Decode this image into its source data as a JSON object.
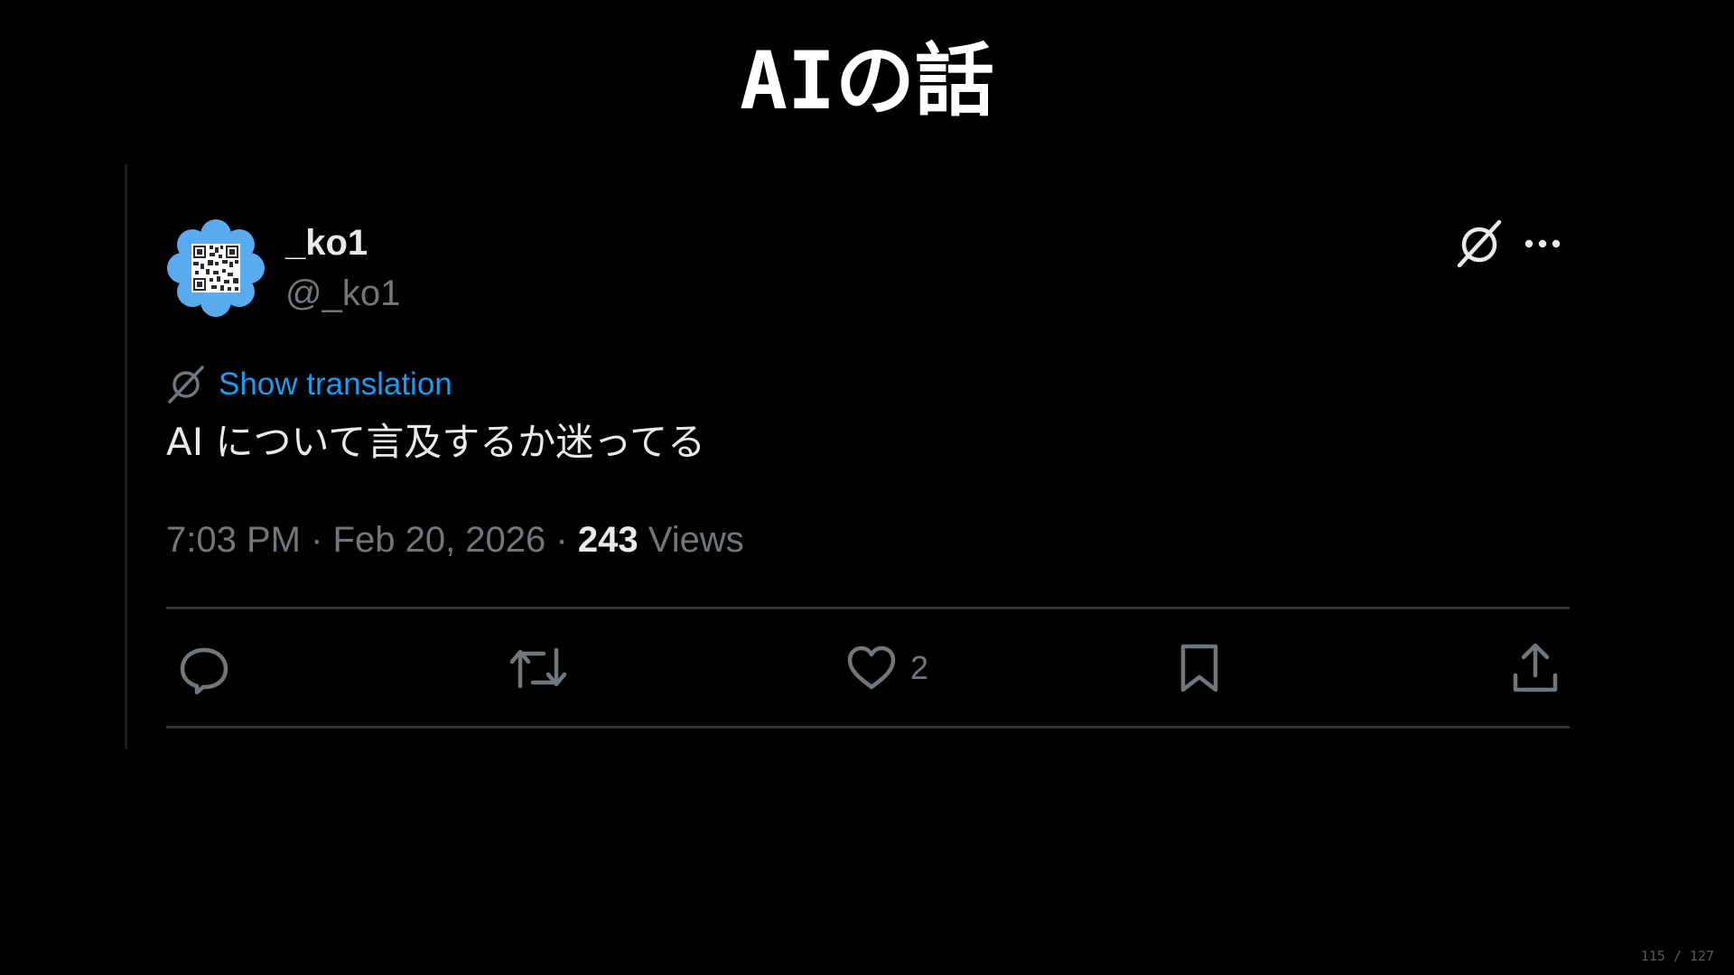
{
  "slide": {
    "title": "AIの話",
    "page_counter": "115 / 127"
  },
  "tweet": {
    "display_name": "_ko1",
    "handle": "@_ko1",
    "translate_label": "Show translation",
    "text": "AI について言及するか迷ってる",
    "time": "7:03 PM",
    "separator": "·",
    "date": "Feb 20, 2026",
    "views_count": "243",
    "views_label": "Views",
    "like_count": "2"
  },
  "icons": {
    "avatar": "qr-code-flower-avatar",
    "grok": "grok-icon",
    "more": "more-horizontal-icon",
    "translate": "translate-icon",
    "reply": "reply-icon",
    "repost": "repost-icon",
    "like": "heart-icon",
    "bookmark": "bookmark-icon",
    "share": "share-icon"
  },
  "colors": {
    "background": "#000000",
    "text_primary": "#e7e9ea",
    "text_secondary": "#71767b",
    "link": "#1d9bf0",
    "divider": "#2f3336",
    "avatar_bg": "#5aaaf0"
  }
}
